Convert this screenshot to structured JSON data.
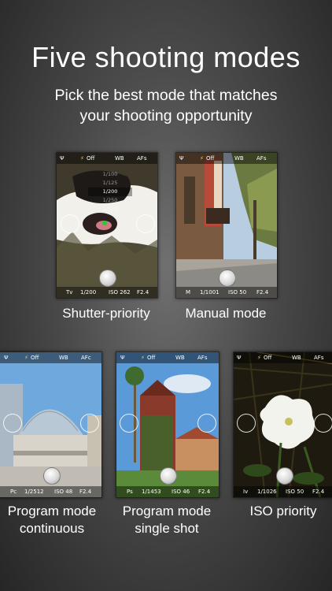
{
  "title": "Five shooting modes",
  "subtitle": "Pick the best mode that matches your shooting opportunity",
  "colors": {
    "background": "#4a4a4a",
    "text": "#ffffff",
    "focus_green": "#22cc33"
  },
  "screens": [
    {
      "label": "Shutter-priority",
      "top": {
        "flash": "Off",
        "wb": "WB",
        "af": "AFs"
      },
      "bottom": {
        "mode": "Tv",
        "shutter": "1/200",
        "iso": "ISO 262",
        "aperture": "F2.4"
      },
      "speed_options": [
        "1/100",
        "1/125",
        "1/200",
        "1/250",
        "1/320"
      ],
      "selected_speed": "1/200"
    },
    {
      "label": "Manual mode",
      "top": {
        "flash": "Off",
        "wb": "WB",
        "af": "AFs"
      },
      "bottom": {
        "mode": "M",
        "shutter": "1/1001",
        "iso": "ISO 50",
        "aperture": "F2.4"
      }
    },
    {
      "label": "Program mode continuous",
      "top": {
        "flash": "Off",
        "wb": "WB",
        "af": "AFc"
      },
      "bottom": {
        "mode": "Pc",
        "shutter": "1/2512",
        "iso": "ISO 48",
        "aperture": "F2.4"
      }
    },
    {
      "label": "Program mode single shot",
      "top": {
        "flash": "Off",
        "wb": "WB",
        "af": "AFs"
      },
      "bottom": {
        "mode": "Ps",
        "shutter": "1/1453",
        "iso": "ISO 46",
        "aperture": "F2.4"
      }
    },
    {
      "label": "ISO priority",
      "top": {
        "flash": "Off",
        "wb": "WB",
        "af": "AFs"
      },
      "bottom": {
        "mode": "Iv",
        "shutter": "1/1026",
        "iso": "ISO 50",
        "aperture": "F2.4"
      }
    }
  ]
}
